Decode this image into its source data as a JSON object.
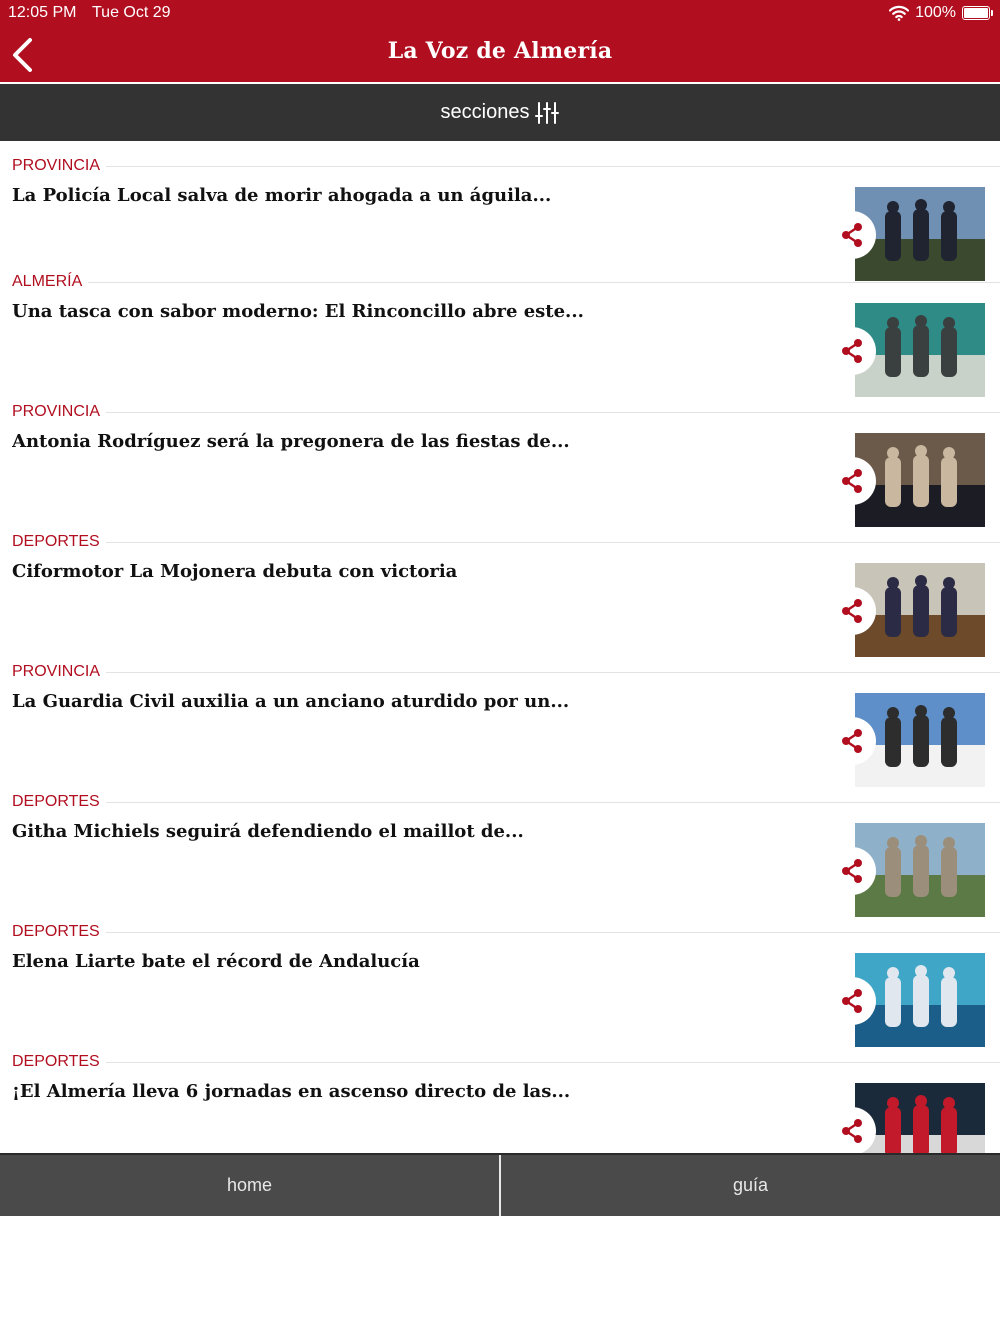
{
  "status": {
    "time": "12:05 PM",
    "date": "Tue Oct 29",
    "battery": "100%"
  },
  "header": {
    "title": "La Voz de Almería",
    "back_icon": "chevron-left-icon"
  },
  "sections_bar": {
    "label": "secciones",
    "icon": "sliders-icon"
  },
  "articles": [
    {
      "category": "PROVINCIA",
      "headline": "La Policía Local salva de morir ahogada a un águila...",
      "image": "three-police-officers-photo"
    },
    {
      "category": "ALMERÍA",
      "headline": "Una tasca con sabor moderno: El Rinconcillo abre este...",
      "image": "restaurant-facade-photo"
    },
    {
      "category": "PROVINCIA",
      "headline": "Antonia Rodríguez será la pregonera de las fiestas de...",
      "image": "officials-group-photo"
    },
    {
      "category": "DEPORTES",
      "headline": "Ciformotor La Mojonera debuta con victoria",
      "image": "basketball-team-celebration-photo"
    },
    {
      "category": "PROVINCIA",
      "headline": "La Guardia Civil auxilia a un anciano aturdido por un...",
      "image": "ambulance-photo"
    },
    {
      "category": "DEPORTES",
      "headline": "Githa Michiels seguirá defendiendo el maillot de...",
      "image": "mountain-bike-race-photo"
    },
    {
      "category": "DEPORTES",
      "headline": "Elena Liarte bate el récord de Andalucía",
      "image": "swimming-podium-photo"
    },
    {
      "category": "DEPORTES",
      "headline": "¡El Almería lleva 6 jornadas en ascenso directo de las...",
      "image": "football-players-celebrating-photo"
    }
  ],
  "tabs": {
    "home": "home",
    "guide": "guía"
  },
  "colors": {
    "brand_red": "#b10e1f",
    "dark_bar": "#333333",
    "tab_bar": "#4a4a4a"
  }
}
